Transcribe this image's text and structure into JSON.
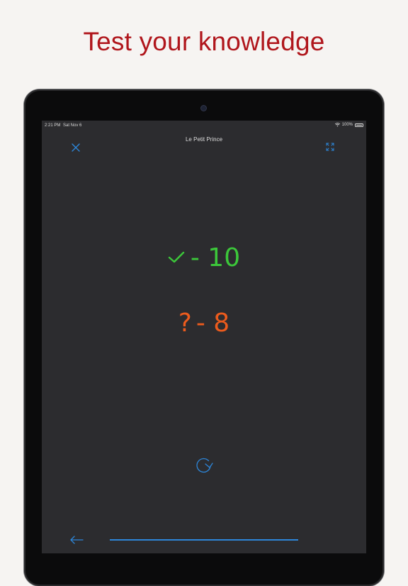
{
  "headline": "Test your knowledge",
  "status_bar": {
    "time": "2:21 PM",
    "date": "Sat Nov 6",
    "battery": "100%"
  },
  "nav": {
    "title": "Le Petit Prince"
  },
  "results": {
    "correct": {
      "icon": "checkmark-icon",
      "value": "- 10",
      "color": "#3cc73a"
    },
    "unknown": {
      "symbol": "?",
      "value": "- 8",
      "color": "#ec5b1d"
    }
  },
  "progress": {
    "fraction": 1.0
  },
  "colors": {
    "accent": "#2d86d9",
    "headline": "#b0161c",
    "screen_bg": "#2c2c2f"
  }
}
